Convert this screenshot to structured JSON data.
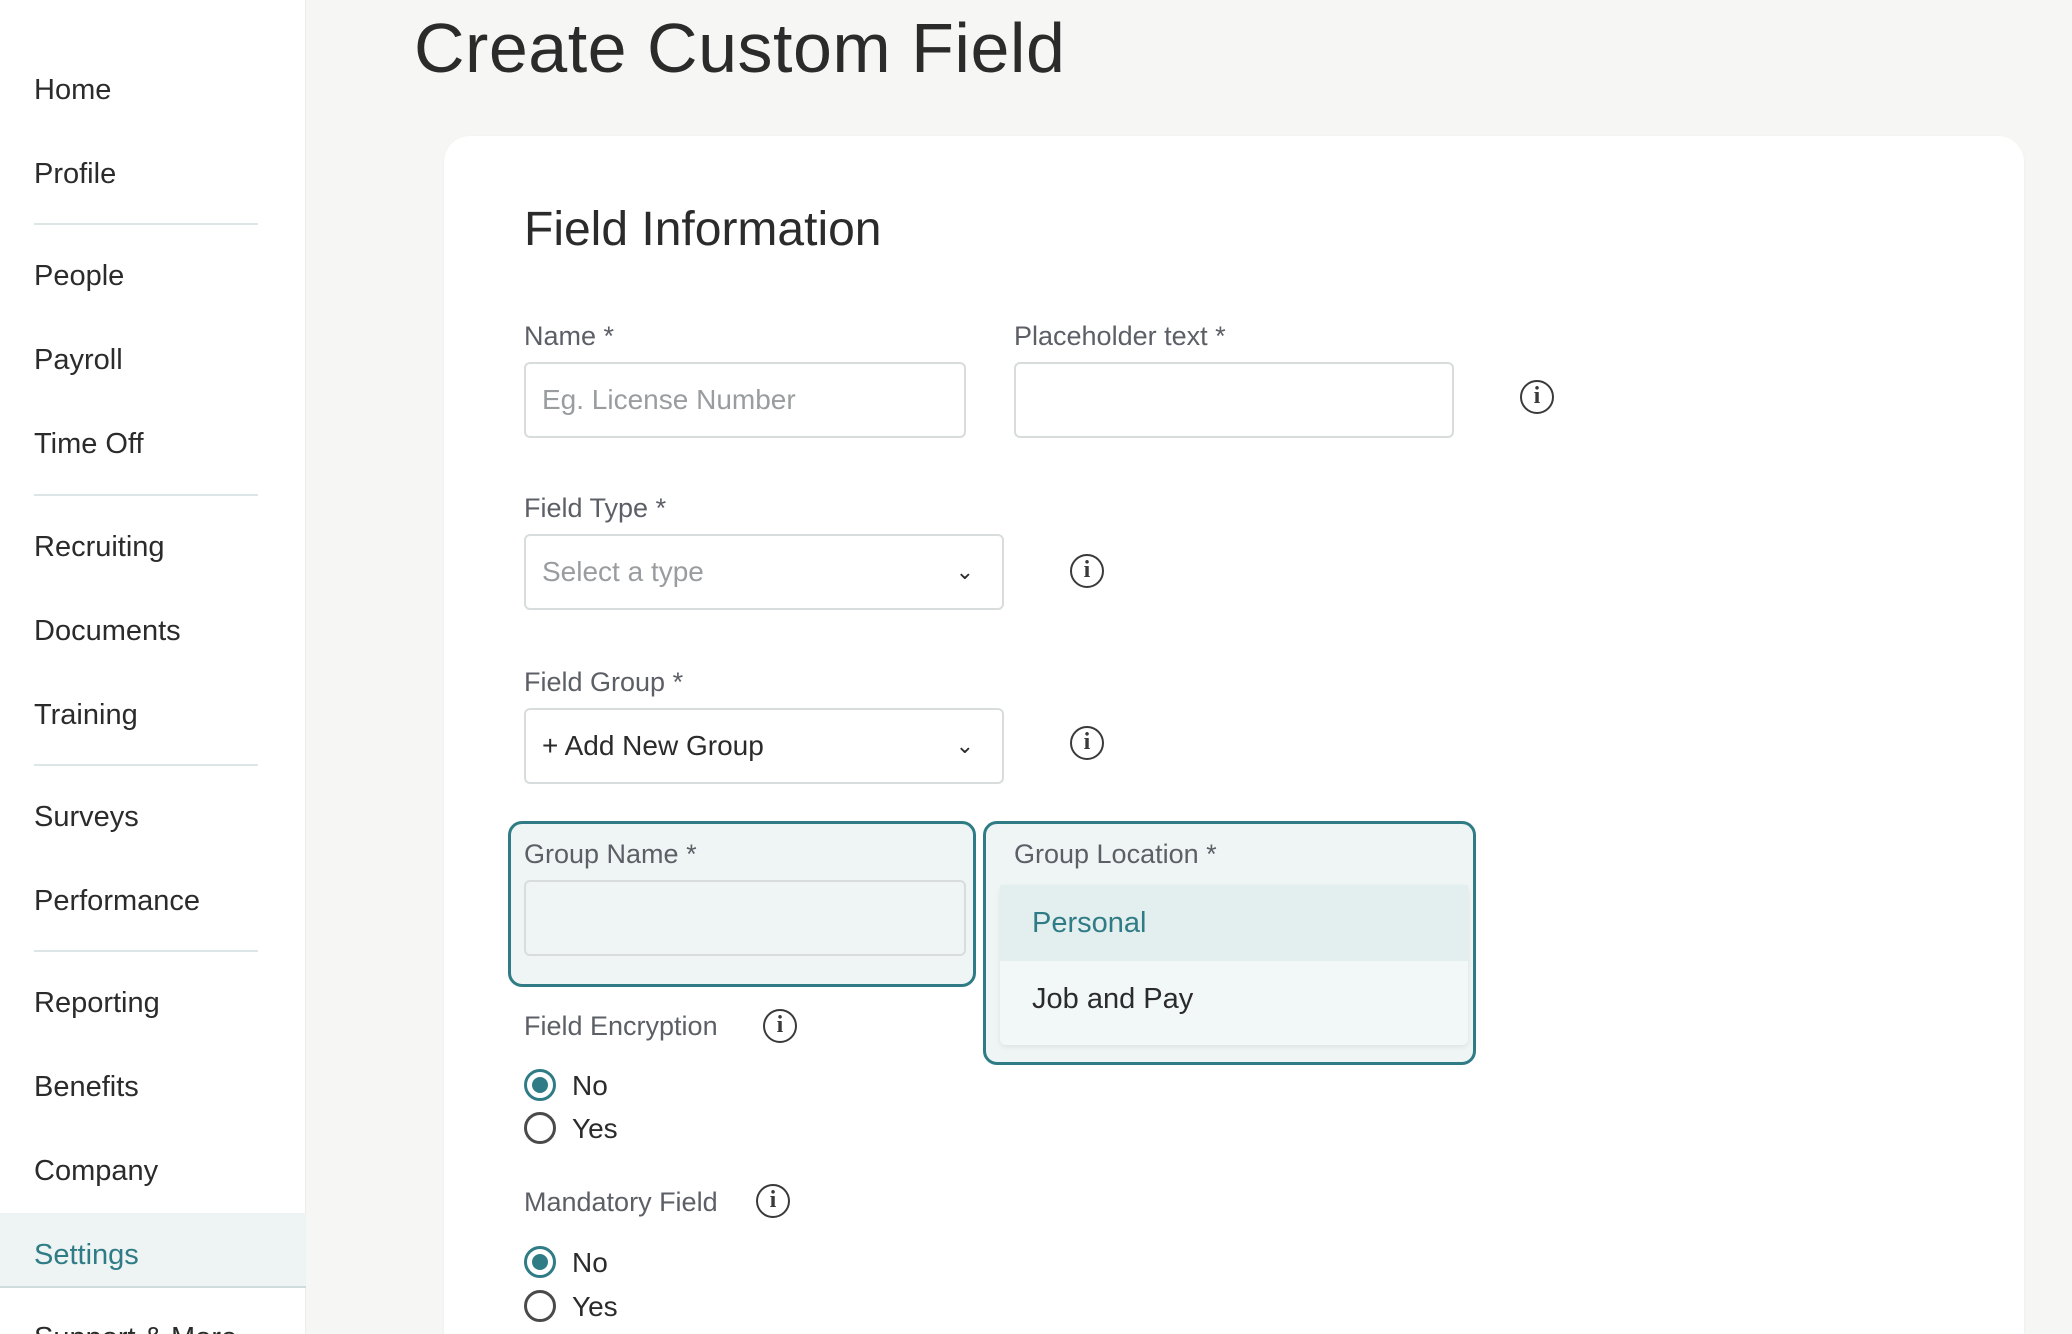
{
  "sidebar": {
    "items": [
      {
        "label": "Home"
      },
      {
        "label": "Profile"
      },
      {
        "label": "People"
      },
      {
        "label": "Payroll"
      },
      {
        "label": "Time Off"
      },
      {
        "label": "Recruiting"
      },
      {
        "label": "Documents"
      },
      {
        "label": "Training"
      },
      {
        "label": "Surveys"
      },
      {
        "label": "Performance"
      },
      {
        "label": "Reporting"
      },
      {
        "label": "Benefits"
      },
      {
        "label": "Company"
      },
      {
        "label": "Settings",
        "active": true
      },
      {
        "label": "Support & More"
      }
    ]
  },
  "page": {
    "title": "Create Custom Field"
  },
  "form": {
    "section_title": "Field Information",
    "name": {
      "label": "Name *",
      "placeholder": "Eg. License Number",
      "value": ""
    },
    "placeholder_text": {
      "label": "Placeholder text *",
      "value": ""
    },
    "field_type": {
      "label": "Field Type *",
      "placeholder": "Select a type"
    },
    "field_group": {
      "label": "Field Group *",
      "value": "+ Add New Group"
    },
    "group_name": {
      "label": "Group Name *",
      "value": ""
    },
    "group_location": {
      "label": "Group Location *",
      "options": [
        "Personal",
        "Job and Pay"
      ],
      "highlighted": "Personal"
    },
    "field_encryption": {
      "label": "Field Encryption",
      "options": [
        "No",
        "Yes"
      ],
      "selected": "No"
    },
    "mandatory_field": {
      "label": "Mandatory Field",
      "options": [
        "No",
        "Yes"
      ],
      "selected": "No"
    }
  },
  "icons": {
    "info": "info-icon",
    "chevron": "chevron-down-icon"
  },
  "colors": {
    "accent": "#2f7c86",
    "background": "#f6f6f5",
    "card": "#ffffff"
  }
}
